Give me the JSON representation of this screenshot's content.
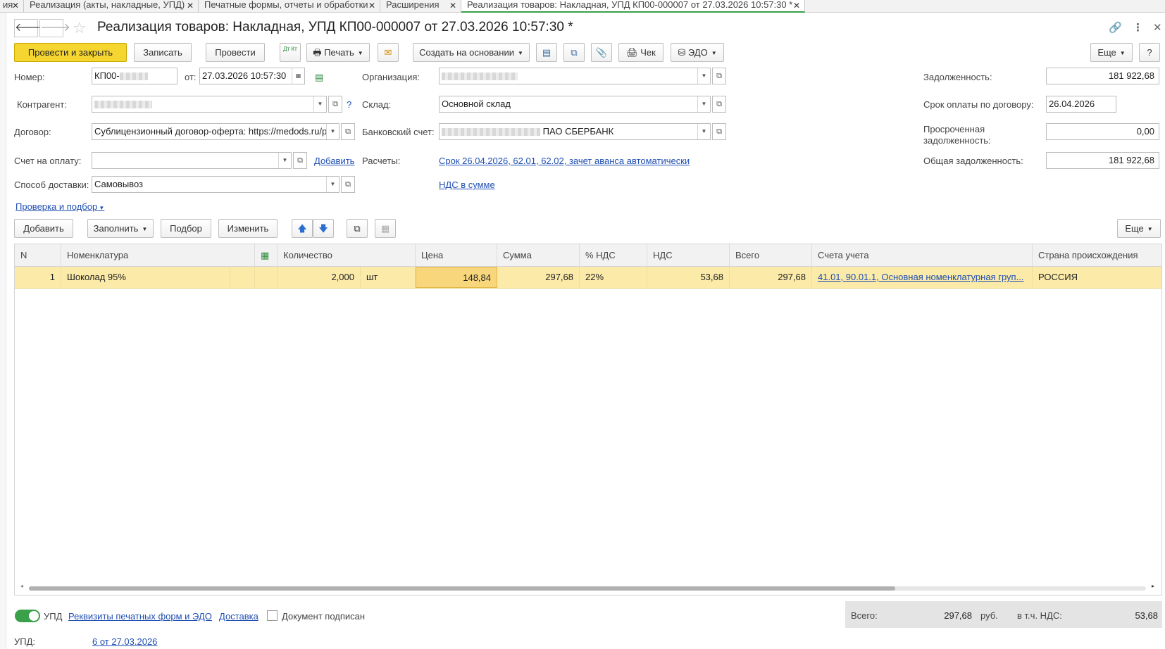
{
  "tabs": [
    {
      "label": "ия"
    },
    {
      "label": "Реализация (акты, накладные, УПД)"
    },
    {
      "label": "Печатные формы, отчеты и обработки"
    },
    {
      "label": "Расширения"
    },
    {
      "label": "Реализация товаров: Накладная, УПД КП00-000007 от 27.03.2026 10:57:30 *"
    }
  ],
  "header": {
    "back_icon": "arrow-left-icon",
    "forward_icon": "arrow-right-icon",
    "title": "Реализация товаров: Накладная, УПД КП00-000007 от 27.03.2026 10:57:30 *"
  },
  "toolbar": {
    "post_close": "Провести и закрыть",
    "save": "Записать",
    "post": "Провести",
    "dt_kt": "Дт Кт",
    "print": "Печать",
    "create_based": "Создать на основании",
    "check": "Чек",
    "edo": "ЭДО",
    "more": "Еще",
    "help": "?"
  },
  "form": {
    "number_label": "Номер:",
    "number_value": "КП00-",
    "from_label": "от:",
    "date_value": "27.03.2026 10:57:30",
    "org_label": "Организация:",
    "counterparty_label": "Контрагент:",
    "warehouse_label": "Склад:",
    "warehouse_value": "Основной склад",
    "contract_label": "Договор:",
    "contract_value": "Сублицензионный договор-оферта: https://medods.ru/p",
    "bank_label": "Банковский счет:",
    "bank_value": "ПАО СБЕРБАНК",
    "invoice_label": "Счет на оплату:",
    "invoice_value": "",
    "add_link": "Добавить",
    "settlements_label": "Расчеты:",
    "settlements_link": "Срок 26.04.2026, 62.01, 62.02, зачет аванса автоматически",
    "delivery_label": "Способ доставки:",
    "delivery_value": "Самовывоз",
    "vat_link": "НДС в сумме",
    "check_link": "Проверка и подбор",
    "help_mark": "?"
  },
  "debt": {
    "debt_label": "Задолженность:",
    "debt_value": "181 922,68",
    "due_label": "Срок оплаты по договору:",
    "due_value": "26.04.2026",
    "overdue_label_1": "Просроченная",
    "overdue_label_2": "задолженность:",
    "overdue_value": "0,00",
    "total_label": "Общая задолженность:",
    "total_value": "181 922,68"
  },
  "table_toolbar": {
    "add": "Добавить",
    "fill": "Заполнить",
    "pick": "Подбор",
    "change": "Изменить",
    "more": "Еще"
  },
  "table": {
    "headers": [
      "N",
      "Номенклатура",
      "Количество",
      "Цена",
      "Сумма",
      "% НДС",
      "НДС",
      "Всего",
      "Счета учета",
      "Страна происхождения"
    ],
    "rows": [
      {
        "n": "1",
        "item": "Шоколад 95%",
        "qty": "2,000",
        "unit": "шт",
        "price": "148,84",
        "sum": "297,68",
        "vat_rate": "22%",
        "vat": "53,68",
        "total": "297,68",
        "accounts": "41.01, 90.01.1, Основная номенклатурная груп...",
        "country": "РОССИЯ"
      }
    ]
  },
  "footer": {
    "upd_toggle_label": "УПД",
    "requisites_link": "Реквизиты печатных форм и ЭДО",
    "delivery_link": "Доставка",
    "signed_label": "Документ подписан",
    "total_label": "Всего:",
    "total_value": "297,68",
    "currency": "руб.",
    "vat_label": "в т.ч. НДС:",
    "vat_value": "53,68",
    "upd_label": "УПД:",
    "upd_link": "6 от 27.03.2026"
  }
}
